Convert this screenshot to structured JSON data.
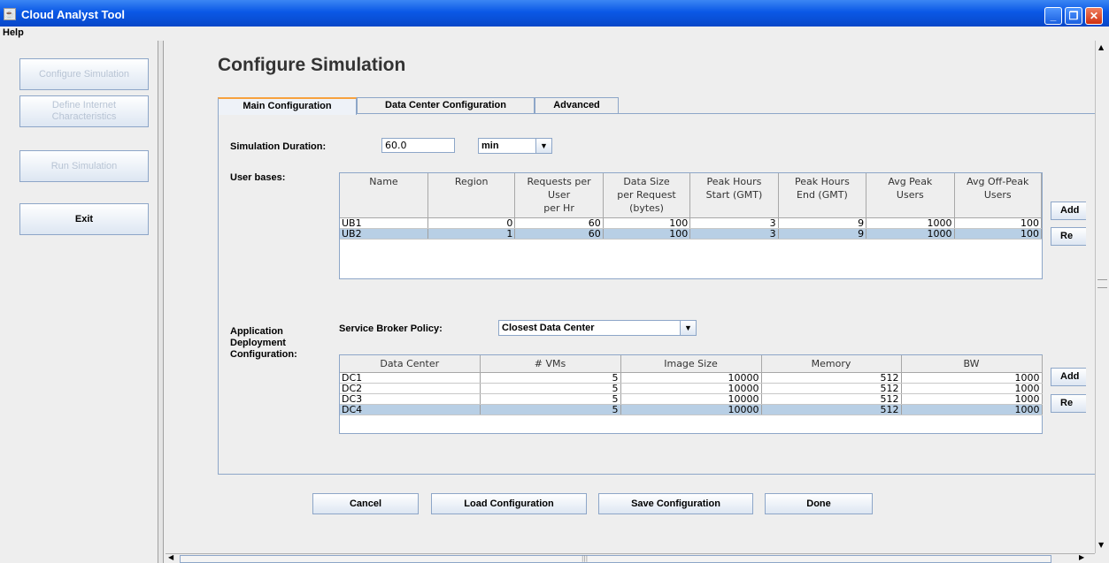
{
  "window": {
    "title": "Cloud Analyst Tool",
    "minimize": "_",
    "maximize": "❐",
    "close": "✕"
  },
  "menu": {
    "help": "Help"
  },
  "sidebar": {
    "configure": "Configure Simulation",
    "define": "Define Internet Characteristics",
    "run": "Run Simulation",
    "exit": "Exit"
  },
  "page": {
    "title": "Configure Simulation"
  },
  "tabs": [
    "Main Configuration",
    "Data Center Configuration",
    "Advanced"
  ],
  "duration": {
    "label": "Simulation Duration:",
    "value": "60.0",
    "unit": "min"
  },
  "userbases": {
    "label": "User bases:",
    "headers": [
      [
        "Name"
      ],
      [
        "Region"
      ],
      [
        "Requests per",
        "User",
        "per Hr"
      ],
      [
        "Data Size",
        "per Request",
        "(bytes)"
      ],
      [
        "Peak Hours",
        "Start (GMT)"
      ],
      [
        "Peak Hours",
        "End (GMT)"
      ],
      [
        "Avg Peak",
        "Users"
      ],
      [
        "Avg Off-Peak",
        "Users"
      ]
    ],
    "rows": [
      [
        "UB1",
        "0",
        "60",
        "100",
        "3",
        "9",
        "1000",
        "100"
      ],
      [
        "UB2",
        "1",
        "60",
        "100",
        "3",
        "9",
        "1000",
        "100"
      ]
    ],
    "add": "Add",
    "remove": "Re"
  },
  "appdeploy": {
    "label1": "Application",
    "label2": "Deployment",
    "label3": "Configuration:",
    "broker_label": "Service Broker Policy:",
    "broker_value": "Closest Data Center",
    "headers": [
      "Data Center",
      "# VMs",
      "Image Size",
      "Memory",
      "BW"
    ],
    "rows": [
      [
        "DC1",
        "5",
        "10000",
        "512",
        "1000"
      ],
      [
        "DC2",
        "5",
        "10000",
        "512",
        "1000"
      ],
      [
        "DC3",
        "5",
        "10000",
        "512",
        "1000"
      ],
      [
        "DC4",
        "5",
        "10000",
        "512",
        "1000"
      ]
    ],
    "add": "Add",
    "remove": "Re"
  },
  "buttons": {
    "cancel": "Cancel",
    "load": "Load Configuration",
    "save": "Save Configuration",
    "done": "Done"
  }
}
